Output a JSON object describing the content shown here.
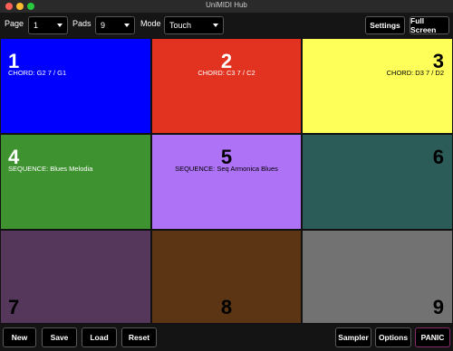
{
  "window": {
    "title": "UniMIDI Hub"
  },
  "toolbar": {
    "page_label": "Page",
    "page_value": "1",
    "pads_label": "Pads",
    "pads_value": "9",
    "mode_label": "Mode",
    "mode_value": "Touch",
    "settings_label": "Settings",
    "fullscreen_label": "Full Screen"
  },
  "pads": [
    {
      "number": "1",
      "label": "CHORD: G2 7 / G1",
      "color": "#0000ff"
    },
    {
      "number": "2",
      "label": "CHORD: C3 7 / C2",
      "color": "#e13320"
    },
    {
      "number": "3",
      "label": "CHORD: D3 7 / D2",
      "color": "#ffff5a"
    },
    {
      "number": "4",
      "label": "SEQUENCE: Blues Melodia",
      "color": "#3e9230"
    },
    {
      "number": "5",
      "label": "SEQUENCE: Seq Armonica Blues",
      "color": "#ae72f7"
    },
    {
      "number": "6",
      "label": "",
      "color": "#2c5c58"
    },
    {
      "number": "7",
      "label": "",
      "color": "#54375a"
    },
    {
      "number": "8",
      "label": "",
      "color": "#5c3614"
    },
    {
      "number": "9",
      "label": "",
      "color": "#727272"
    }
  ],
  "bottom": {
    "new_label": "New",
    "save_label": "Save",
    "load_label": "Load",
    "reset_label": "Reset",
    "sampler_label": "Sampler",
    "options_label": "Options",
    "panic_label": "PANIC"
  }
}
